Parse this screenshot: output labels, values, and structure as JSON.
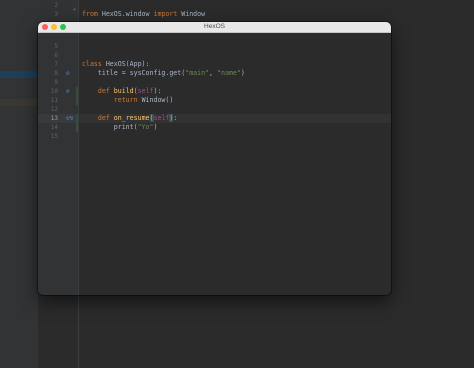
{
  "editor": {
    "background_lines": [
      {
        "num": "2",
        "code": []
      },
      {
        "num": "3",
        "code": [
          {
            "t": "from ",
            "c": "kw"
          },
          {
            "t": "HexOS.window ",
            "c": ""
          },
          {
            "t": "import ",
            "c": "kw"
          },
          {
            "t": "Window",
            "c": ""
          }
        ]
      }
    ]
  },
  "window": {
    "title": "HexOS",
    "lines": [
      {
        "num": "5",
        "code": []
      },
      {
        "num": "6",
        "code": []
      },
      {
        "num": "7",
        "code": [
          {
            "t": "class ",
            "c": "kw"
          },
          {
            "t": "HexOS(App):",
            "c": ""
          }
        ]
      },
      {
        "num": "8",
        "glyph": "override",
        "code": [
          {
            "t": "    title = sysConfig.get(",
            "c": ""
          },
          {
            "t": "\"main\"",
            "c": "str"
          },
          {
            "t": ", ",
            "c": ""
          },
          {
            "t": "\"name\"",
            "c": "str"
          },
          {
            "t": ")",
            "c": ""
          }
        ]
      },
      {
        "num": "9",
        "code": []
      },
      {
        "num": "10",
        "glyph": "override",
        "fold": true,
        "code": [
          {
            "t": "    ",
            "c": ""
          },
          {
            "t": "def ",
            "c": "kw"
          },
          {
            "t": "build",
            "c": "fn"
          },
          {
            "t": "(",
            "c": ""
          },
          {
            "t": "self",
            "c": "self"
          },
          {
            "t": "):",
            "c": ""
          }
        ]
      },
      {
        "num": "11",
        "fold": true,
        "code": [
          {
            "t": "        ",
            "c": ""
          },
          {
            "t": "return ",
            "c": "kw"
          },
          {
            "t": "Window()",
            "c": ""
          }
        ]
      },
      {
        "num": "12",
        "code": []
      },
      {
        "num": "13",
        "glyph": "override-breakpoint",
        "current": true,
        "fold": true,
        "code": [
          {
            "t": "    ",
            "c": ""
          },
          {
            "t": "def ",
            "c": "kw"
          },
          {
            "t": "on_resume",
            "c": "fn"
          },
          {
            "t": "(",
            "c": "hl"
          },
          {
            "t": "self",
            "c": "self"
          },
          {
            "t": ")",
            "c": "hl"
          },
          {
            "t": ":",
            "c": ""
          }
        ]
      },
      {
        "num": "14",
        "fold": true,
        "code": [
          {
            "t": "        print(",
            "c": ""
          },
          {
            "t": "\"Yo\"",
            "c": "str"
          },
          {
            "t": ")",
            "c": ""
          }
        ]
      },
      {
        "num": "15",
        "code": []
      }
    ]
  }
}
